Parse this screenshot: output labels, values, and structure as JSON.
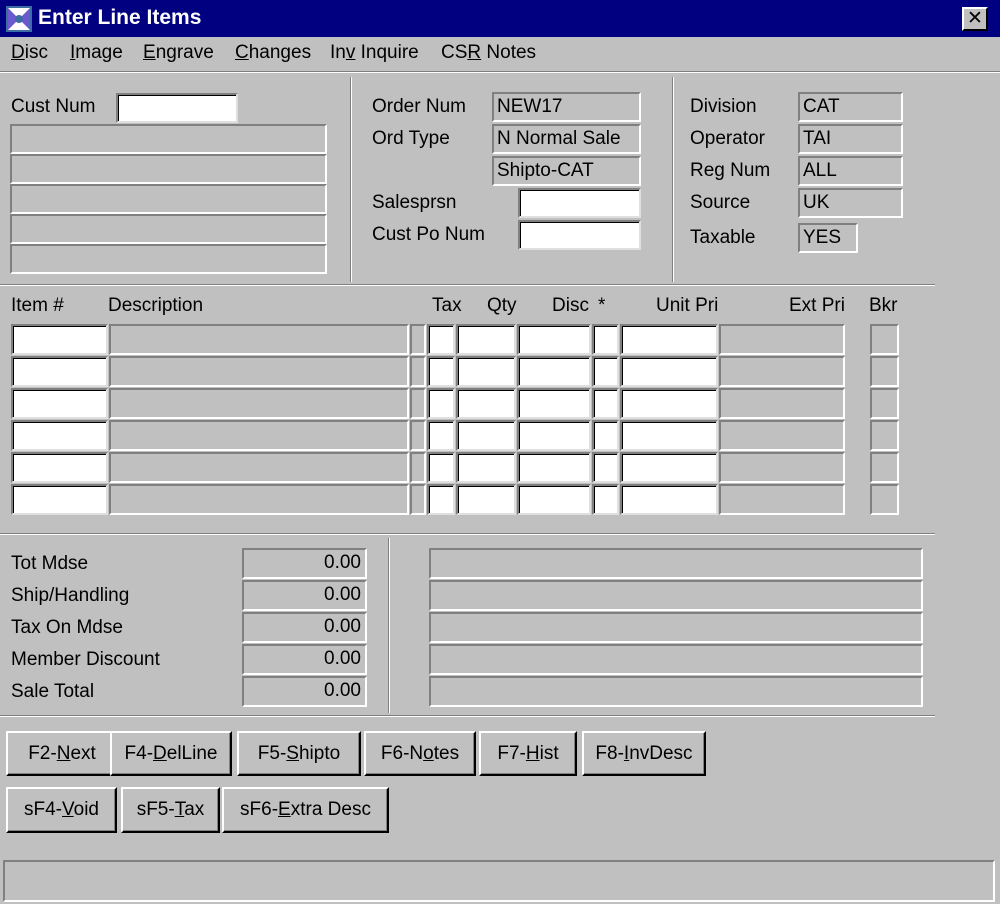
{
  "window": {
    "title": "Enter Line Items",
    "close_glyph": "✕",
    "icon": "app-icon"
  },
  "menu": [
    {
      "pre": "",
      "key": "D",
      "post": "isc"
    },
    {
      "pre": "",
      "key": "I",
      "post": "mage"
    },
    {
      "pre": "",
      "key": "E",
      "post": "ngrave"
    },
    {
      "pre": "",
      "key": "C",
      "post": "hanges"
    },
    {
      "pre": "In",
      "key": "v",
      "post": " Inquire"
    },
    {
      "pre": "CS",
      "key": "R",
      "post": " Notes"
    }
  ],
  "customer": {
    "cust_num_label": "Cust Num",
    "cust_num_value": "",
    "address_lines": [
      "",
      "",
      "",
      "",
      ""
    ]
  },
  "order": {
    "order_num_label": "Order Num",
    "order_num": "NEW17",
    "ord_type_label": "Ord Type",
    "ord_type": "N Normal Sale",
    "shipto": "Shipto-CAT",
    "salesprsn_label": "Salesprsn",
    "salesprsn": "",
    "cust_po_label": "Cust Po Num",
    "cust_po": ""
  },
  "division": {
    "division_label": "Division",
    "division": "CAT",
    "operator_label": "Operator",
    "operator": "TAI",
    "reg_num_label": "Reg Num",
    "reg_num": "ALL",
    "source_label": "Source",
    "source": "UK",
    "taxable_label": "Taxable",
    "taxable": "YES"
  },
  "line_items": {
    "headers": {
      "item": "Item #",
      "description": "Description",
      "tax": "Tax",
      "qty": "Qty",
      "disc": "Disc",
      "star": "*",
      "unit_price": "Unit Pri",
      "ext_price": "Ext Pri",
      "bkr": "Bkr"
    },
    "row_count": 6
  },
  "totals": [
    {
      "label": "Tot Mdse",
      "value": "0.00"
    },
    {
      "label": "Ship/Handling",
      "value": "0.00"
    },
    {
      "label": "Tax On Mdse",
      "value": "0.00"
    },
    {
      "label": "Member Discount",
      "value": "0.00"
    },
    {
      "label": "Sale Total",
      "value": "0.00"
    }
  ],
  "buttons_row1": [
    {
      "pre": "F2-",
      "key": "N",
      "post": "ext"
    },
    {
      "pre": "F4-",
      "key": "D",
      "post": "elLine"
    },
    {
      "pre": "F5-",
      "key": "S",
      "post": "hipto"
    },
    {
      "pre": "F6-N",
      "key": "o",
      "post": "tes"
    },
    {
      "pre": "F7-",
      "key": "H",
      "post": "ist"
    },
    {
      "pre": "F8-",
      "key": "I",
      "post": "nvDesc"
    }
  ],
  "buttons_row2": [
    {
      "pre": "sF4-",
      "key": "V",
      "post": "oid"
    },
    {
      "pre": "sF5-",
      "key": "T",
      "post": "ax"
    },
    {
      "pre": "sF6-",
      "key": "E",
      "post": "xtra Desc"
    }
  ]
}
